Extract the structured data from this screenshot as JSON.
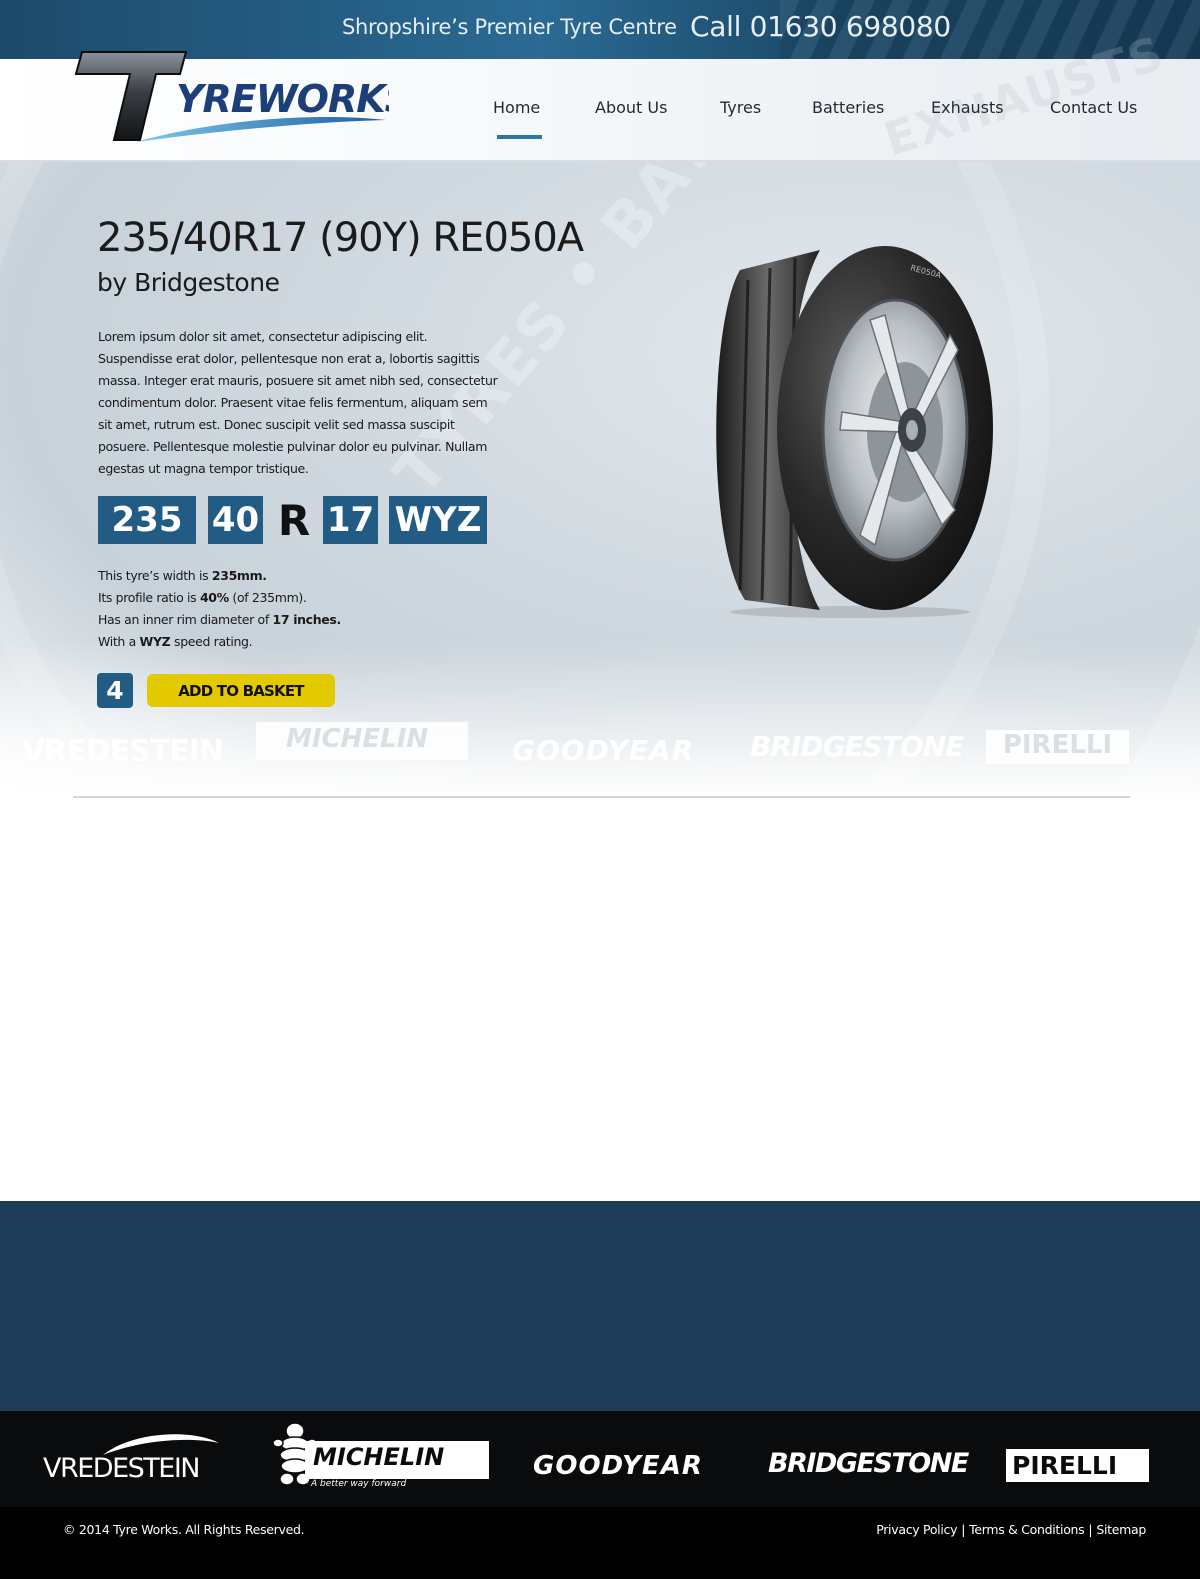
{
  "topbar": {
    "tagline": "Shropshire’s Premier Tyre Centre",
    "phone": "Call 01630 698080"
  },
  "header": {
    "logo_text_t": "T",
    "logo_text_rest": "YREWORKS",
    "nav": [
      {
        "label": "Home",
        "active": true
      },
      {
        "label": "About Us"
      },
      {
        "label": "Tyres"
      },
      {
        "label": "Batteries"
      },
      {
        "label": "Exhausts"
      },
      {
        "label": "Contact Us"
      }
    ],
    "watermark": "TYRES • BATTERIES • EXHAUSTS"
  },
  "product": {
    "title": "235/40R17 (90Y) RE050A",
    "brand_line": "by Bridgestone",
    "description": "Lorem ipsum dolor sit amet, consectetur adipiscing elit. Suspendisse erat dolor, pellentesque non erat a, lobortis sagittis massa. Integer erat mauris, posuere sit amet nibh sed, consectetur condimentum dolor. Praesent vitae felis fermentum, aliquam sem sit amet, rutrum est. Donec suscipit velit sed massa suscipit posuere. Pellentesque molestie pulvinar dolor eu pulvinar. Nullam egestas ut magna tempor tristique.",
    "size": {
      "width": "235",
      "profile": "40",
      "construction": "R",
      "rim": "17",
      "speed": "WYZ"
    },
    "specs": {
      "width_prefix": "This tyre’s width is ",
      "width_value": "235mm.",
      "profile_prefix": "Its profile ratio is ",
      "profile_value": "40%",
      "profile_suffix": " (of 235mm).",
      "rim_prefix": "Has an inner rim diameter of ",
      "rim_value": "17 inches.",
      "speed_prefix": "With a ",
      "speed_value": "WYZ",
      "speed_suffix": " speed rating."
    },
    "quantity": "4",
    "add_to_basket": "ADD TO BASKET",
    "tyre_sidewall_text": "RE050A"
  },
  "brands": [
    "VREDESTEIN",
    "MICHELIN",
    "GOODYEAR",
    "BRIDGESTONE",
    "PIRELLI"
  ],
  "michelin_slogan": "A better way forward",
  "footer": {
    "copyright": "© 2014 Tyre Works. All Rights Reserved.",
    "links": [
      "Privacy Policy",
      "Terms & Conditions",
      "Sitemap"
    ],
    "separator": "|"
  },
  "colors": {
    "accent_blue": "#225c85",
    "nav_underline": "#2b78a0",
    "basket_yellow": "#e3c900",
    "footer_blue": "#1c3c59"
  }
}
